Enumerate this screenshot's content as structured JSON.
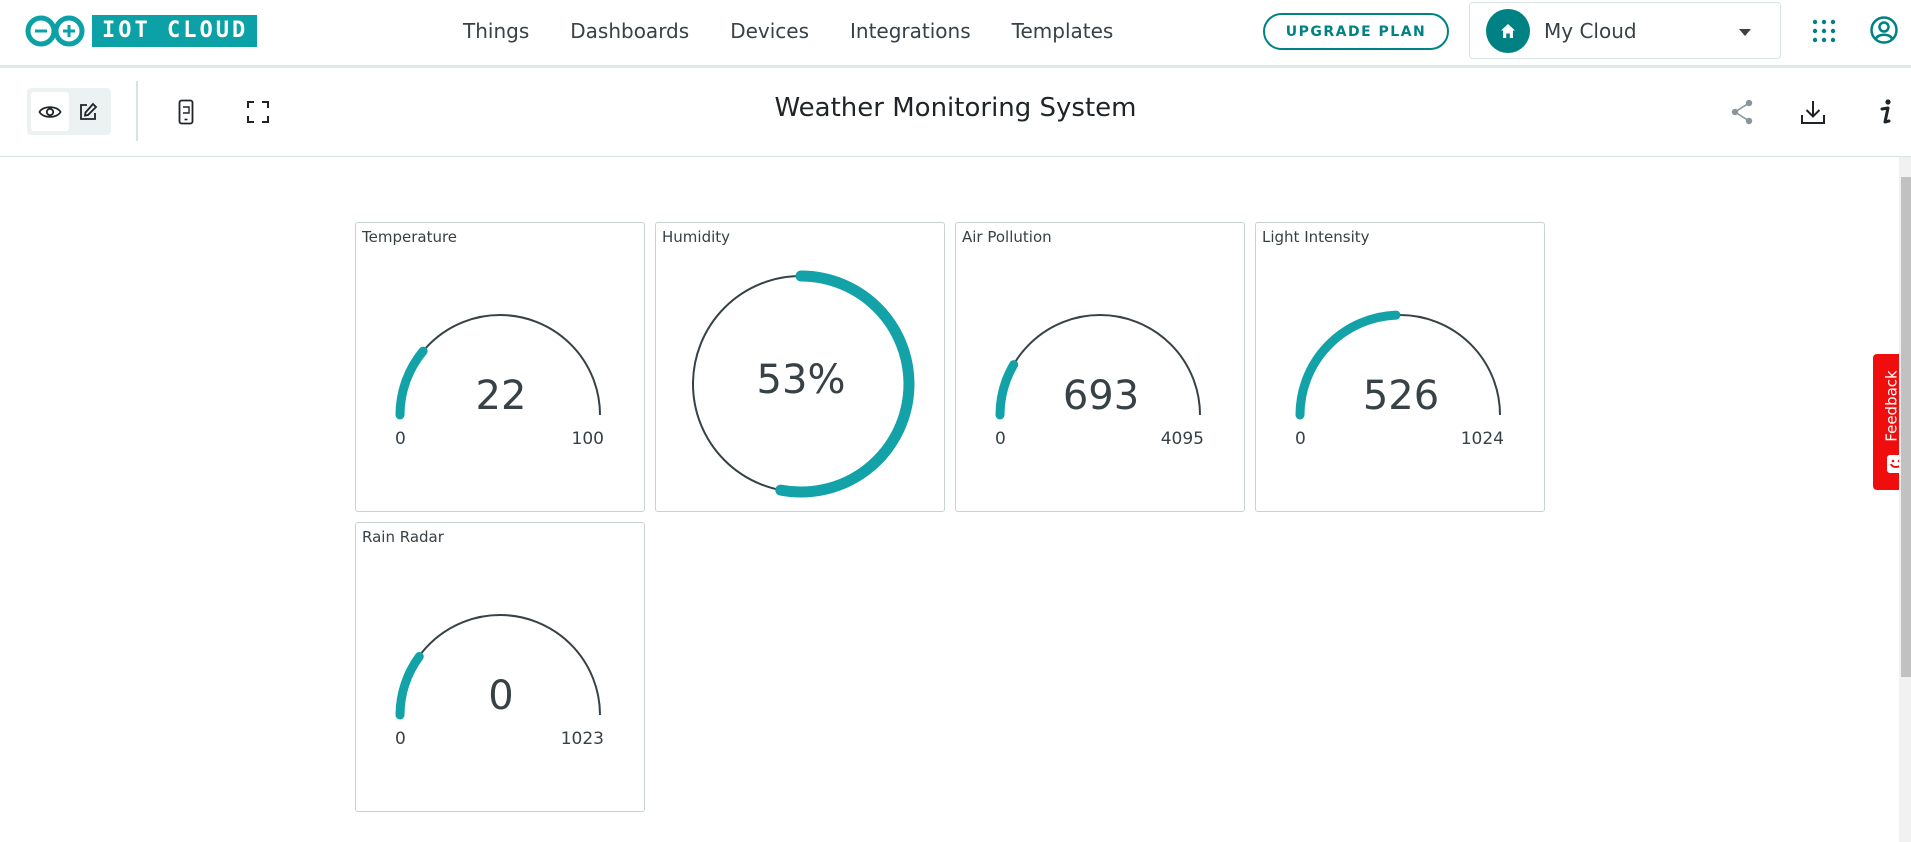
{
  "brand": {
    "logo_text": "IOT CLOUD",
    "accent_color": "#0ca1a6",
    "primary_color": "#008184"
  },
  "nav": {
    "links": [
      "Things",
      "Dashboards",
      "Devices",
      "Integrations",
      "Templates"
    ]
  },
  "header": {
    "upgrade_label": "UPGRADE PLAN",
    "space_name": "My Cloud"
  },
  "toolbar": {
    "title": "Weather Monitoring System",
    "icons": [
      "view-mode-icon",
      "edit-mode-icon",
      "mobile-view-icon",
      "fullscreen-icon",
      "share-icon",
      "download-icon",
      "info-icon"
    ]
  },
  "widgets": [
    {
      "title": "Temperature",
      "type": "gauge",
      "value": "22",
      "min": "0",
      "max": "100"
    },
    {
      "title": "Humidity",
      "type": "percentage",
      "value": "53%"
    },
    {
      "title": "Air Pollution",
      "type": "gauge",
      "value": "693",
      "min": "0",
      "max": "4095"
    },
    {
      "title": "Light Intensity",
      "type": "gauge",
      "value": "526",
      "min": "0",
      "max": "1024"
    },
    {
      "title": "Rain Radar",
      "type": "gauge",
      "value": "0",
      "min": "0",
      "max": "1023"
    }
  ],
  "feedback": {
    "label": "Feedback",
    "color": "#f00d0d"
  }
}
